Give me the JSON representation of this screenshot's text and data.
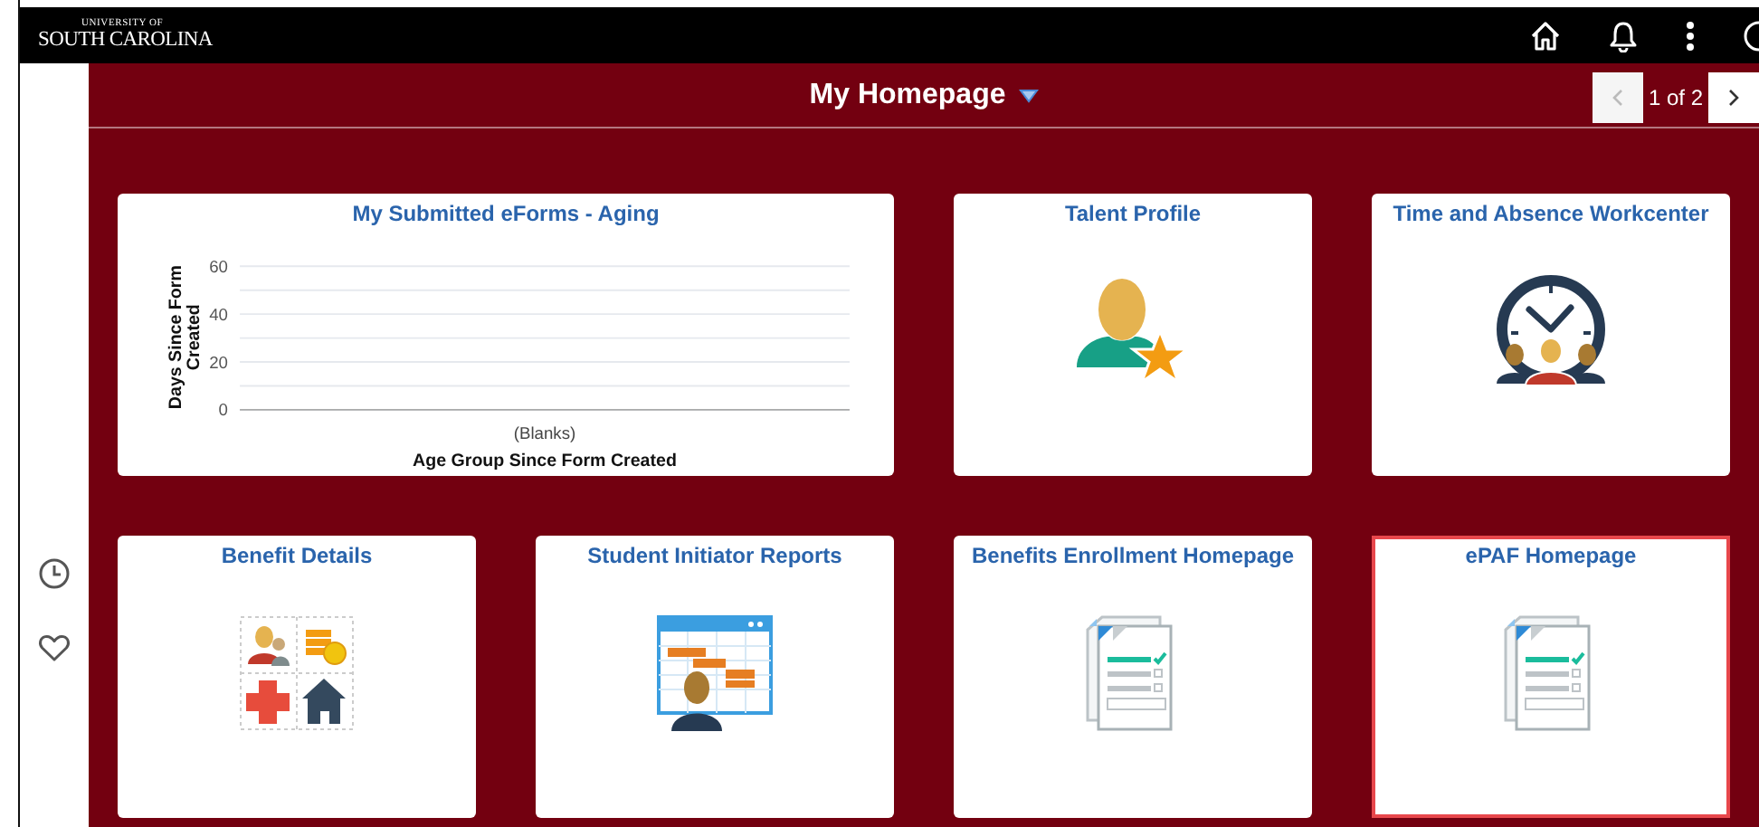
{
  "logo": {
    "small": "UNIVERSITY OF",
    "main": "SOUTH CAROLINA"
  },
  "header_icons": [
    {
      "kind": "home"
    },
    {
      "kind": "bell"
    },
    {
      "kind": "more"
    },
    {
      "kind": "cut"
    }
  ],
  "page_title": "My Homepage",
  "pager": {
    "prev_disabled": true,
    "text": "1 of 2",
    "next_disabled": false
  },
  "sidebar": [
    {
      "kind": "recent"
    },
    {
      "kind": "favorites"
    }
  ],
  "tiles": [
    {
      "title": "My Submitted eForms - Aging",
      "kind": "chart",
      "selected": false,
      "chart_data": {
        "type": "bar",
        "xlabel": "Age Group Since Form Created",
        "ylabel": "Days Since Form Created",
        "categories": [
          "(Blanks)"
        ],
        "values": [
          null
        ],
        "ylim": [
          0,
          60
        ],
        "yticks": [
          0,
          20,
          40,
          60
        ]
      }
    },
    {
      "title": "Talent Profile",
      "kind": "talent",
      "selected": false
    },
    {
      "title": "Time and Absence Workcenter",
      "kind": "clock",
      "selected": false
    },
    {
      "title": "Benefit Details",
      "kind": "benefits",
      "selected": false
    },
    {
      "title": "Student Initiator Reports",
      "kind": "report",
      "selected": false
    },
    {
      "title": "Benefits Enrollment Homepage",
      "kind": "form",
      "selected": false
    },
    {
      "title": "ePAF Homepage",
      "kind": "form",
      "selected": true
    }
  ]
}
